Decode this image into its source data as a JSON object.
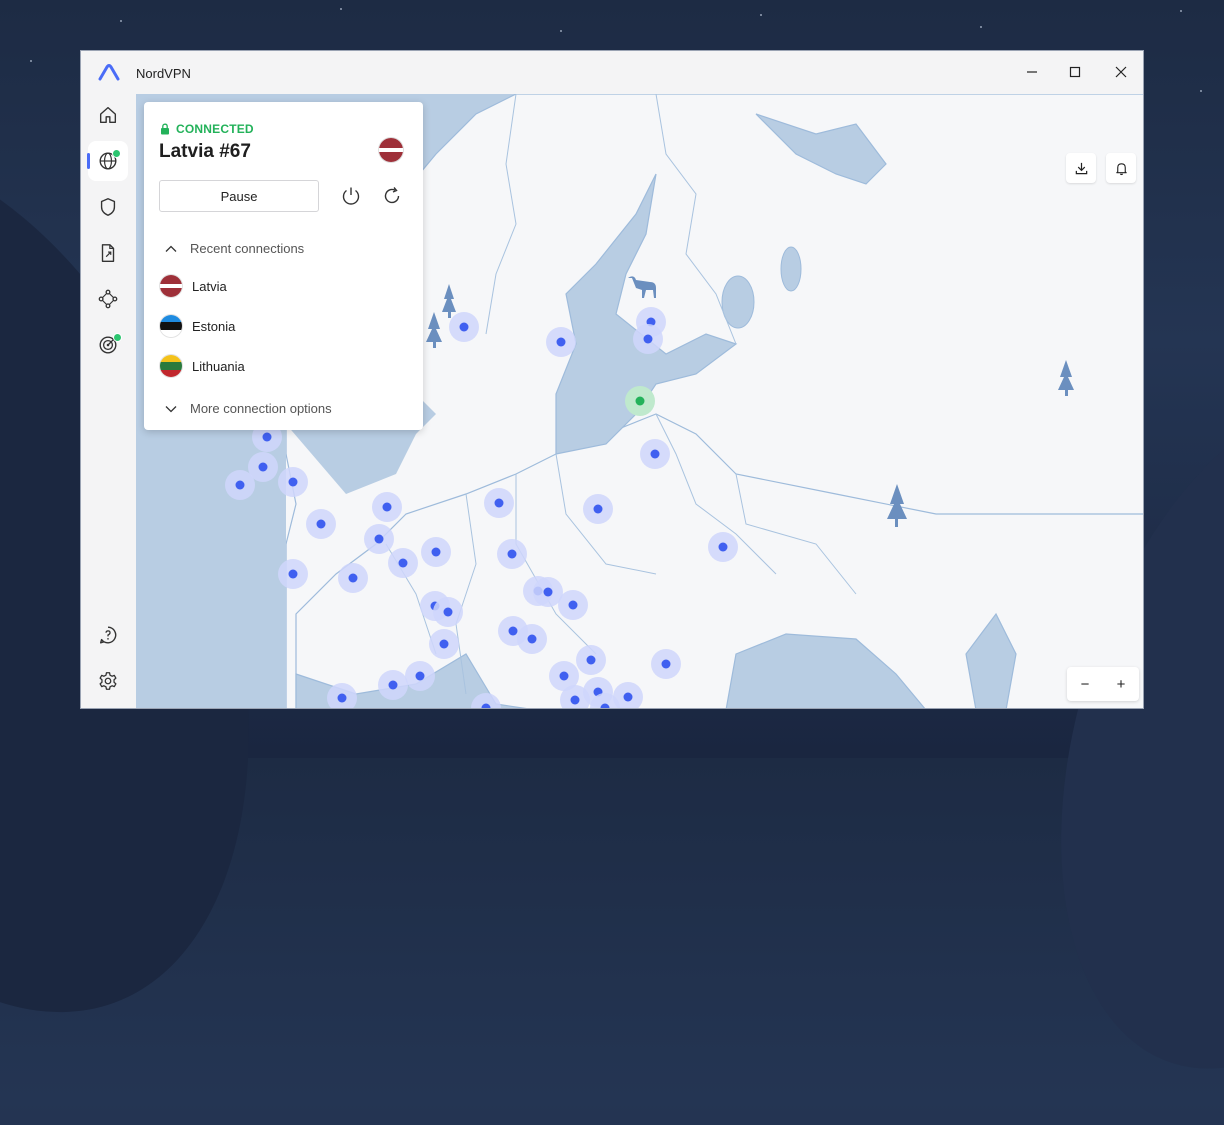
{
  "window": {
    "app_title": "NordVPN",
    "controls": [
      "minimize-icon",
      "maximize-icon",
      "close-icon"
    ]
  },
  "sidebar": {
    "items": [
      {
        "name": "home",
        "icon": "home-icon",
        "active": false
      },
      {
        "name": "servers",
        "icon": "globe-icon",
        "active": true,
        "badge": true
      },
      {
        "name": "threat-protection",
        "icon": "shield-icon",
        "active": false
      },
      {
        "name": "file-share",
        "icon": "file-share-icon",
        "active": false
      },
      {
        "name": "meshnet",
        "icon": "meshnet-icon",
        "active": false
      },
      {
        "name": "dark-web-monitor",
        "icon": "target-icon",
        "active": false,
        "badge": true
      },
      {
        "name": "help",
        "icon": "help-icon",
        "active": false
      },
      {
        "name": "settings",
        "icon": "gear-icon",
        "active": false
      }
    ]
  },
  "connection": {
    "status": "CONNECTED",
    "server": "Latvia #67",
    "pause_label": "Pause",
    "flag": "latvia"
  },
  "recent": {
    "header": "Recent connections",
    "items": [
      {
        "label": "Latvia",
        "flag": "latvia"
      },
      {
        "label": "Estonia",
        "flag": "estonia"
      },
      {
        "label": "Lithuania",
        "flag": "lithuania"
      }
    ],
    "more_label": "More connection options"
  },
  "map_controls": {
    "zoom_out": "−",
    "zoom_in": "+",
    "tools": [
      "download-icon",
      "bell-icon"
    ]
  },
  "colors": {
    "water": "#b8cde3",
    "land": "#f6f7f9",
    "server_dot": "#4060f0",
    "server_halo": "#cfd6fb",
    "connected": "#23b25a",
    "accent": "#4a6cf7"
  }
}
